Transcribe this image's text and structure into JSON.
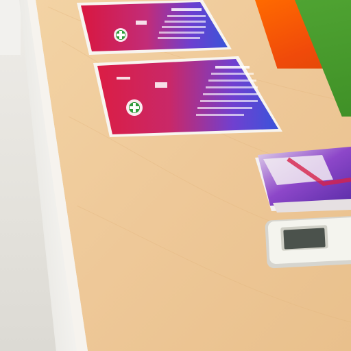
{
  "scene": {
    "description_visible_text": "",
    "objects": [
      {
        "name": "wooden-counter",
        "color": "#eec998"
      },
      {
        "name": "poster-upper",
        "colors": [
          "#d81e4a",
          "#3a4fd6"
        ]
      },
      {
        "name": "poster-lower",
        "colors": [
          "#dc1f48",
          "#3b52d8"
        ]
      },
      {
        "name": "brochure",
        "colors": [
          "#7a3cc8",
          "#f2ecef"
        ]
      },
      {
        "name": "remote-control",
        "color": "#f4f4ee"
      },
      {
        "name": "orange-panel",
        "color": "#f25a05"
      },
      {
        "name": "green-panel",
        "color": "#438f2a"
      }
    ]
  }
}
